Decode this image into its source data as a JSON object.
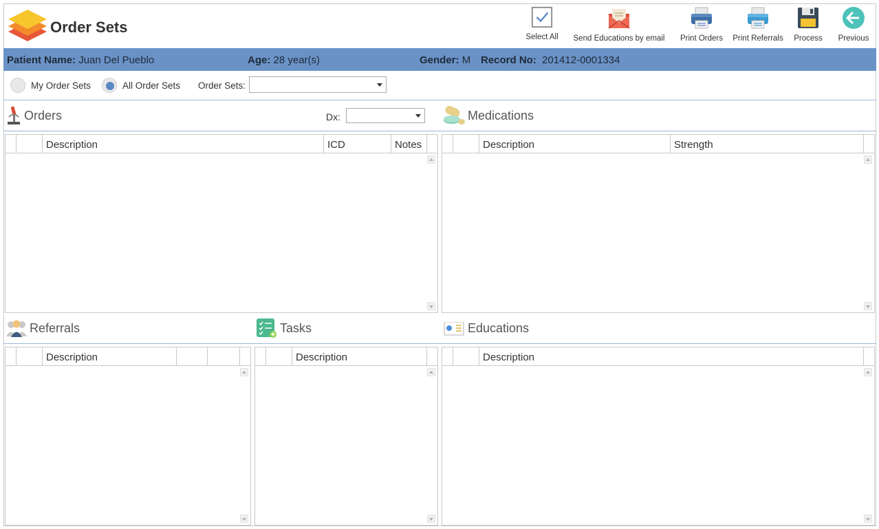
{
  "app": {
    "title": "Order Sets"
  },
  "toolbar": {
    "select_all": "Select All",
    "send_educations": "Send Educations by email",
    "print_orders": "Print Orders",
    "print_referrals": "Print Referrals",
    "process": "Process",
    "previous": "Previous"
  },
  "patient": {
    "name_label": "Patient Name:",
    "name": "Juan Del Pueblo",
    "age_label": "Age:",
    "age": "28 year(s)",
    "gender_label": "Gender:",
    "gender": "M",
    "record_label": "Record No:",
    "record": "201412-0001334"
  },
  "filters": {
    "my_order_sets": "My Order Sets",
    "all_order_sets": "All Order Sets",
    "selected": "All Order Sets",
    "order_sets_label": "Order Sets:",
    "order_sets_value": "",
    "dx_label": "Dx:",
    "dx_value": ""
  },
  "sections": {
    "orders": {
      "title": "Orders",
      "columns": [
        "Description",
        "ICD",
        "Notes"
      ],
      "rows": []
    },
    "medications": {
      "title": "Medications",
      "columns": [
        "Description",
        "Strength"
      ],
      "rows": []
    },
    "referrals": {
      "title": "Referrals",
      "columns": [
        "Description"
      ],
      "rows": []
    },
    "tasks": {
      "title": "Tasks",
      "columns": [
        "Description"
      ],
      "rows": []
    },
    "educations": {
      "title": "Educations",
      "columns": [
        "Description"
      ],
      "rows": []
    }
  },
  "colors": {
    "patient_bar": "#6a92c6",
    "accent": "#5b87c5",
    "divider": "#9ab7d8"
  },
  "icons": {
    "logo": "layers-logo-icon",
    "select_all": "checkbox-icon",
    "send_educations": "envelope-icon",
    "print_orders": "printer-icon",
    "print_referrals": "printer-icon",
    "process": "floppy-disk-icon",
    "previous": "arrow-left-circle-icon"
  }
}
